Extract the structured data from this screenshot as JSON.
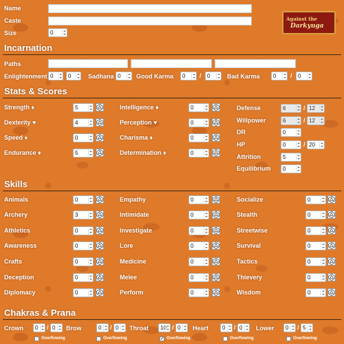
{
  "header": {
    "name_label": "Name",
    "caste_label": "Caste",
    "size_label": "Size",
    "size_value": "0"
  },
  "logo": {
    "line1": "Against the",
    "line2": "Darkyuga",
    "colors": {
      "bg": "#8d1a10",
      "border": "#d9a441"
    }
  },
  "incarnation": {
    "title": "Incarnation",
    "paths_label": "Paths",
    "enlightenment_label": "Enlightenment",
    "enlightenment_value": "0",
    "enlightenment_max": "0",
    "sadhana_label": "Sadhana",
    "sadhana_value": "0",
    "good_karma_label": "Good Karma",
    "good_karma_value": "0",
    "good_karma_max": "0",
    "bad_karma_label": "Bad Karma",
    "bad_karma_value": "0",
    "bad_karma_max": "0"
  },
  "stats": {
    "title": "Stats & Scores",
    "attributes": [
      {
        "label": "Strength ♦",
        "value": "5"
      },
      {
        "label": "Dexterity ♥",
        "value": "4"
      },
      {
        "label": "Speed ♦",
        "value": "0"
      },
      {
        "label": "Endurance ♦",
        "value": "5"
      }
    ],
    "mental": [
      {
        "label": "Intelligence ♦",
        "value": "0"
      },
      {
        "label": "Perception ♥",
        "value": "0"
      },
      {
        "label": "Charisma ♦",
        "value": "0"
      },
      {
        "label": "Determination ♦",
        "value": "0"
      }
    ],
    "scores": [
      {
        "label": "Defense",
        "value": "6",
        "max": "12"
      },
      {
        "label": "Willpower",
        "value": "6",
        "max": "12"
      },
      {
        "label": "DR",
        "value": "0"
      },
      {
        "label": "HP",
        "value": "0",
        "max": "20"
      },
      {
        "label": "Attrition",
        "value": "5"
      },
      {
        "label": "Equilibrium",
        "value": "0"
      }
    ]
  },
  "skills": {
    "title": "Skills",
    "col1": [
      {
        "label": "Animals",
        "value": "0"
      },
      {
        "label": "Archery",
        "value": "3"
      },
      {
        "label": "Athletics",
        "value": "0"
      },
      {
        "label": "Awareness",
        "value": "0"
      },
      {
        "label": "Crafts",
        "value": "0"
      },
      {
        "label": "Deception",
        "value": "0"
      },
      {
        "label": "Diplomacy",
        "value": "0"
      }
    ],
    "col2": [
      {
        "label": "Empathy",
        "value": "0"
      },
      {
        "label": "Intimidate",
        "value": "0"
      },
      {
        "label": "Investigate",
        "value": "0"
      },
      {
        "label": "Lore",
        "value": "0"
      },
      {
        "label": "Medicine",
        "value": "0"
      },
      {
        "label": "Melee",
        "value": "0"
      },
      {
        "label": "Perform",
        "value": "0"
      }
    ],
    "col3": [
      {
        "label": "Socialize",
        "value": "0"
      },
      {
        "label": "Stealth",
        "value": "0"
      },
      {
        "label": "Streetwise",
        "value": "0"
      },
      {
        "label": "Survival",
        "value": "0"
      },
      {
        "label": "Tactics",
        "value": "0"
      },
      {
        "label": "Thievery",
        "value": "0"
      },
      {
        "label": "Wisdom",
        "value": "0"
      }
    ]
  },
  "chakras": {
    "title": "Chakras & Prana",
    "overflowing_label": "Overflowing",
    "items": [
      {
        "label": "Crown",
        "value": "0",
        "max": "0",
        "overflowing": false
      },
      {
        "label": "Brow",
        "value": "0",
        "max": "0",
        "overflowing": false
      },
      {
        "label": "Throat",
        "value": "10",
        "max": "0",
        "overflowing": true
      },
      {
        "label": "Heart",
        "value": "0",
        "max": "0",
        "overflowing": false
      },
      {
        "label": "Lower",
        "value": "0",
        "max": "5",
        "overflowing": false
      }
    ]
  }
}
